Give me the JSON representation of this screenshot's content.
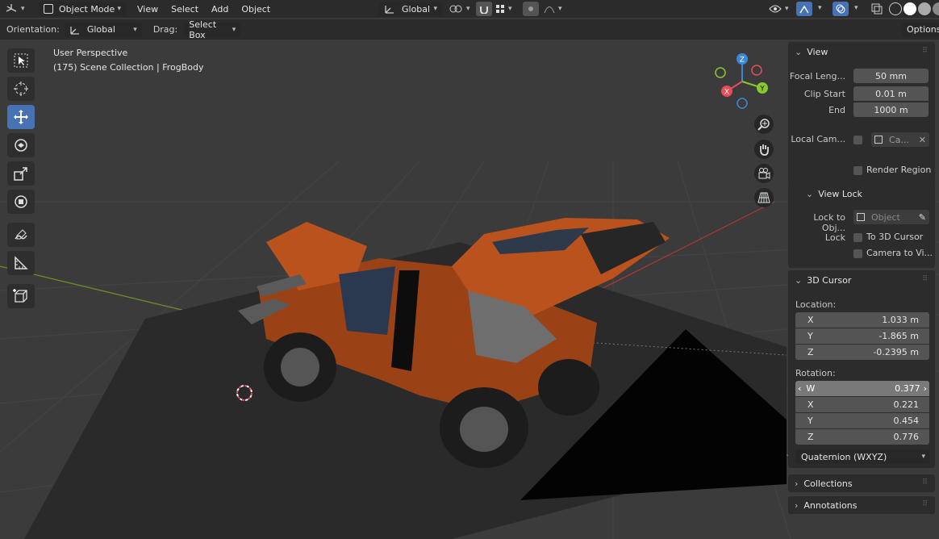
{
  "header": {
    "mode": "Object Mode",
    "menus": [
      "View",
      "Select",
      "Add",
      "Object"
    ],
    "transform_orientation": "Global"
  },
  "tool_header": {
    "orientation_label": "Orientation:",
    "orientation_value": "Global",
    "drag_label": "Drag:",
    "drag_value": "Select Box",
    "options_label": "Options"
  },
  "viewport": {
    "perspective": "User Perspective",
    "scene_info": "(175) Scene Collection | FrogBody",
    "gizmo_axes": [
      "Z",
      "Y",
      "X"
    ]
  },
  "sidebar": {
    "view": {
      "title": "View",
      "focal_label": "Focal Leng...",
      "focal_value": "50 mm",
      "clip_start_label": "Clip Start",
      "clip_start_value": "0.01 m",
      "end_label": "End",
      "end_value": "1000 m",
      "local_cam_label": "Local Cam...",
      "local_cam_value": "Ca...",
      "render_region_label": "Render Region"
    },
    "view_lock": {
      "title": "View Lock",
      "lock_to_obj_label": "Lock to Obj...",
      "lock_to_obj_placeholder": "Object",
      "lock_label": "Lock",
      "to_cursor_label": "To 3D Cursor",
      "camera_to_view_label": "Camera to Vi..."
    },
    "cursor": {
      "title": "3D Cursor",
      "location_label": "Location:",
      "location": [
        {
          "axis": "X",
          "value": "1.033 m"
        },
        {
          "axis": "Y",
          "value": "-1.865 m"
        },
        {
          "axis": "Z",
          "value": "-0.2395 m"
        }
      ],
      "rotation_label": "Rotation:",
      "rotation": [
        {
          "axis": "W",
          "value": "0.377"
        },
        {
          "axis": "X",
          "value": "0.221"
        },
        {
          "axis": "Y",
          "value": "0.454"
        },
        {
          "axis": "Z",
          "value": "0.776"
        }
      ],
      "rotation_mode": "Quaternion (WXYZ)"
    },
    "collections_title": "Collections",
    "annotations_title": "Annotations"
  },
  "colors": {
    "accent": "#4772b3",
    "x_axis": "#e64c5a",
    "y_axis": "#8ac82f",
    "z_axis": "#3b88d6",
    "body": "#b9521c"
  }
}
